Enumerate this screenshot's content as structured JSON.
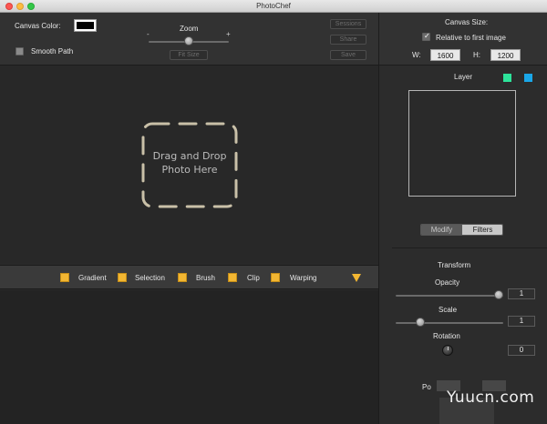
{
  "window": {
    "title": "PhotoChef"
  },
  "top": {
    "canvas_color_label": "Canvas Color:",
    "canvas_color": "#000000",
    "smooth_path_label": "Smooth Path",
    "smooth_path_checked": false,
    "zoom_label": "Zoom",
    "zoom_minus": "-",
    "zoom_plus": "+",
    "zoom_level": 0.5,
    "fit_size_label": "Fit Size",
    "sessions_label": "Sessions",
    "share_label": "Share",
    "save_label": "Save"
  },
  "canvas_size": {
    "title": "Canvas Size:",
    "relative_label": "Relative to first image",
    "relative_checked": true,
    "w_label": "W:",
    "w_value": "1600",
    "h_label": "H:",
    "h_value": "1200"
  },
  "dropzone": {
    "line1": "Drag and Drop",
    "line2": "Photo Here"
  },
  "tools": {
    "items": [
      {
        "label": "Gradient"
      },
      {
        "label": "Selection"
      },
      {
        "label": "Brush"
      },
      {
        "label": "Clip"
      },
      {
        "label": "Warping"
      }
    ],
    "accent": "#f2b632"
  },
  "layer": {
    "title": "Layer",
    "chip_green": "#2de39a",
    "chip_blue": "#1aa7e8",
    "tabs": [
      {
        "label": "Modify",
        "active": false
      },
      {
        "label": "Filters",
        "active": true
      }
    ]
  },
  "transform": {
    "title": "Transform",
    "opacity_label": "Opacity",
    "opacity_value": "1",
    "scale_label": "Scale",
    "scale_value": "1",
    "rotation_label": "Rotation",
    "rotation_value": "0",
    "cut_label": "Po"
  },
  "watermark": "Yuucn.com"
}
